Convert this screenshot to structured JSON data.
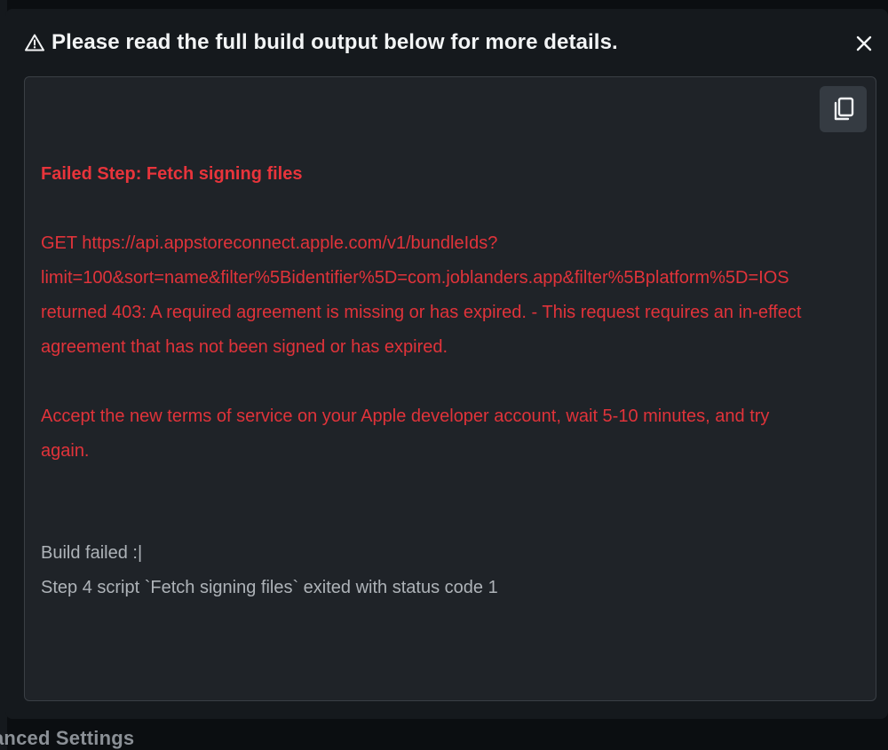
{
  "modal": {
    "title": "Please read the full build output below for more details.",
    "warning_icon": "warning-triangle-icon",
    "close_icon": "close-icon",
    "copy_icon": "copy-icon"
  },
  "log": {
    "failed_step": "Failed Step: Fetch signing files",
    "error_lines": [
      "GET https://api.appstoreconnect.apple.com/v1/bundleIds?",
      "limit=100&sort=name&filter%5Bidentifier%5D=com.joblanders.app&filter%5Bplatform%5D=IOS",
      "returned 403: A required agreement is missing or has expired. - This request requires an in-effect",
      "agreement that has not been signed or has expired."
    ],
    "hint_lines": [
      "Accept the new terms of service on your Apple developer account, wait 5-10 minutes, and try",
      "again."
    ],
    "status_lines": [
      "Build failed :|",
      "Step 4 script `Fetch signing files` exited with status code 1"
    ]
  },
  "background": {
    "footer_label": "anced Settings"
  },
  "colors": {
    "error": "#e0333a",
    "muted": "#aeb3b8",
    "panel": "#1f2328",
    "modal": "#15191d"
  }
}
